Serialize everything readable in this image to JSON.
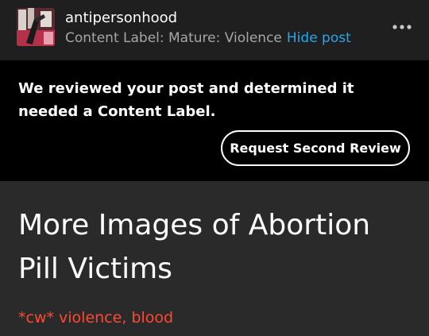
{
  "post": {
    "username": "antipersonhood",
    "content_label": "Content Label: Mature: Violence",
    "hide_post_label": "Hide post",
    "more_menu_icon": "more-horizontal-icon"
  },
  "notice": {
    "message": "We reviewed your post and determined it needed a Content Label.",
    "request_review_label": "Request Second Review"
  },
  "body": {
    "title": "More Images of Abortion Pill Victims",
    "content_warning": "*cw* violence, blood"
  },
  "colors": {
    "link_blue": "#22a7f0",
    "warning_red": "#ff4930",
    "header_bg": "#1f1f1f",
    "body_bg": "#2a2a2a"
  }
}
